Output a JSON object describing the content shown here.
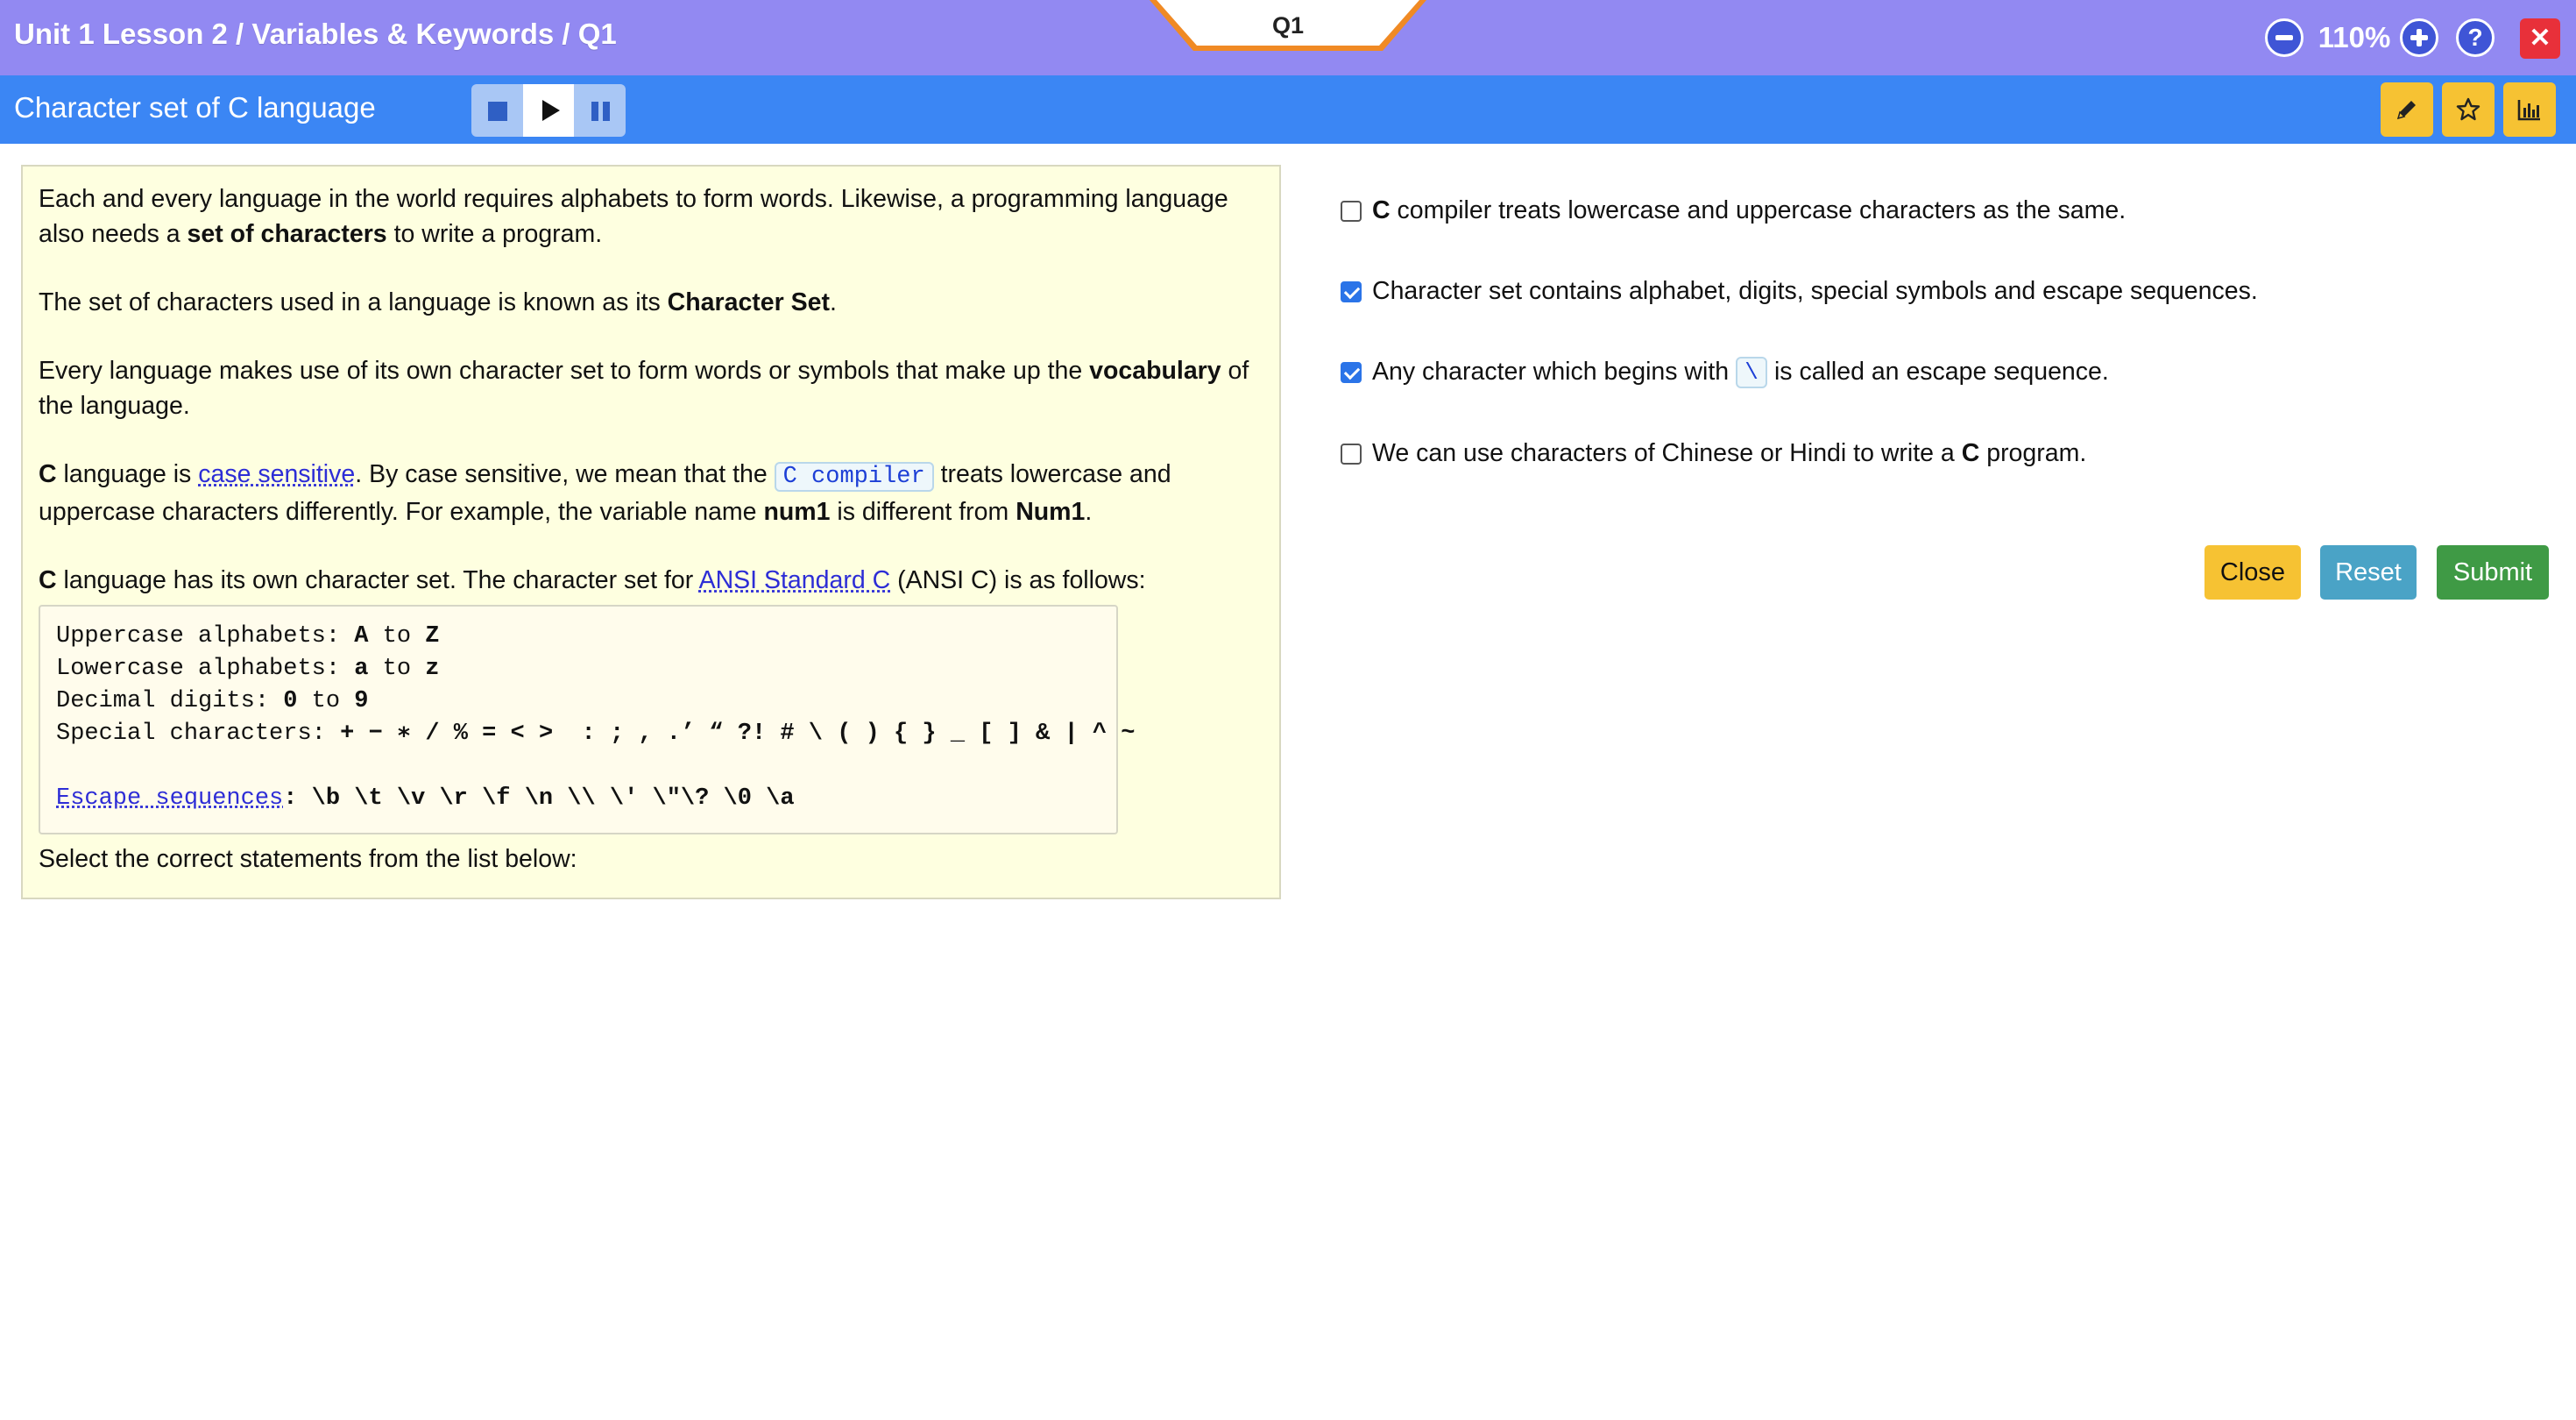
{
  "header": {
    "breadcrumb": "Unit 1 Lesson 2 / Variables & Keywords / Q1",
    "question_tab": "Q1",
    "zoom_level": "110%",
    "help_label": "?",
    "close_label": "✕"
  },
  "subheader": {
    "title": "Character set of C language",
    "player": [
      "stop-icon",
      "play-icon",
      "pause-icon"
    ],
    "tools": [
      "pencil-icon",
      "star-icon",
      "bar-chart-icon"
    ]
  },
  "content": {
    "p1_a": "Each and every language in the world requires alphabets to form words. Likewise, a programming language also needs a ",
    "p1_b": "set of characters",
    "p1_c": " to write a program.",
    "p2_a": "The set of characters used in a language is known as its ",
    "p2_b": "Character Set",
    "p2_c": ".",
    "p3_a": "Every language makes use of its own character set to form words or symbols that make up the ",
    "p3_b": "vocabulary",
    "p3_c": " of the language.",
    "p4_c": "C",
    "p4_a": " language is ",
    "p4_link": "case sensitive",
    "p4_b": ". By case sensitive, we mean that the ",
    "p4_code": "C compiler",
    "p4_d": " treats lowercase and uppercase characters differently. For example, the variable name ",
    "p4_num1": "num1",
    "p4_e": " is different from ",
    "p4_num2": "Num1",
    "p4_f": ".",
    "p5_c": "C",
    "p5_a": " language has its own character set. The character set for ",
    "p5_link": "ANSI Standard C",
    "p5_b": " (ANSI C) is as follows:",
    "code": {
      "upper_label": "Uppercase alphabets: ",
      "upper_a": "A",
      "upper_to": " to ",
      "upper_z": "Z",
      "lower_label": "Lowercase alphabets: ",
      "lower_a": "a",
      "lower_to": " to ",
      "lower_z": "z",
      "digits_label": "Decimal digits: ",
      "digits_0": "0",
      "digits_to": " to ",
      "digits_9": "9",
      "special_label": "Special characters: ",
      "special_value": "+ − ∗ / % = < >  : ; , .’ “ ?! # \\ ( ) { } _ [ ] & | ^ ~",
      "escape_link": "Escape sequences",
      "escape_colon": ": ",
      "escape_value": "\\b \\t \\v \\r \\f \\n \\\\ \\' \\\"\\? \\0 \\a"
    },
    "instruction": "Select the correct statements from the list below:"
  },
  "statements": [
    {
      "checked": false,
      "bold": "C",
      "text": " compiler treats lowercase and uppercase characters as the same."
    },
    {
      "checked": true,
      "text": "Character set contains alphabet, digits, special symbols and escape sequences."
    },
    {
      "checked": true,
      "text_a": "Any character which begins with ",
      "code": "\\",
      "text_b": " is called an escape sequence."
    },
    {
      "checked": false,
      "text": "We can use characters of Chinese or Hindi to write a ",
      "bold": "C",
      "text_end": " program."
    }
  ],
  "actions": {
    "close": "Close",
    "reset": "Reset",
    "submit": "Submit"
  },
  "colors": {
    "header_bg": "#9289f2",
    "subheader_bg": "#3b86f4",
    "panel_bg": "#feffe0",
    "close_button": "#f6c233",
    "reset_button": "#4aa3c6",
    "submit_button": "#3f9a45"
  }
}
